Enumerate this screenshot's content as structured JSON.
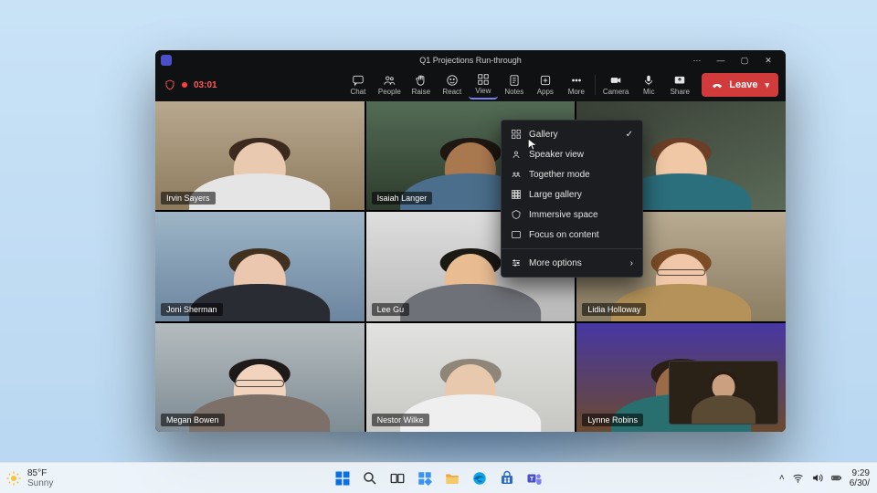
{
  "meeting": {
    "title": "Q1 Projections Run-through",
    "recording_time": "03:01"
  },
  "toolbar": {
    "chat": "Chat",
    "people": "People",
    "raise": "Raise",
    "react": "React",
    "view": "View",
    "notes": "Notes",
    "apps": "Apps",
    "more": "More",
    "camera": "Camera",
    "mic": "Mic",
    "share": "Share",
    "leave_label": "Leave"
  },
  "view_menu": {
    "gallery": "Gallery",
    "speaker": "Speaker view",
    "together": "Together mode",
    "large_gallery": "Large gallery",
    "immersive": "Immersive space",
    "focus": "Focus on content",
    "more_options": "More options"
  },
  "participants": [
    {
      "name": "Irvin Sayers",
      "skin": "#e9c9b0",
      "shirt": "#e5e5e5",
      "hair": "#3b2a1d",
      "bg": "linear-gradient(180deg,#b8a88e,#8e7b5e)"
    },
    {
      "name": "Isaiah Langer",
      "skin": "#a9784f",
      "shirt": "#4a6e8b",
      "hair": "#1e1712",
      "bg": "linear-gradient(180deg,#536b55,#2e3c2d)"
    },
    {
      "name": "",
      "skin": "#f1c8a6",
      "shirt": "#2b6e7c",
      "hair": "#6a3e27",
      "bg": "linear-gradient(160deg,#3a4036,#5a6a58)"
    },
    {
      "name": "Joni Sherman",
      "skin": "#ecc7af",
      "shirt": "#2a2c33",
      "hair": "#40301f",
      "bg": "linear-gradient(180deg,#9db5c6,#6d86a0)"
    },
    {
      "name": "Lee Gu",
      "skin": "#e9bc92",
      "shirt": "#6f7178",
      "hair": "#1b1914",
      "bg": "linear-gradient(180deg,#dedede,#b9b9b9)"
    },
    {
      "name": "Lidia Holloway",
      "skin": "#f0c8a9",
      "shirt": "#b49259",
      "hair": "#7c4c27",
      "bg": "linear-gradient(180deg,#b8ab92,#8c7e63)"
    },
    {
      "name": "Megan Bowen",
      "skin": "#f2d3bd",
      "shirt": "#7d7068",
      "hair": "#1e1a19",
      "bg": "linear-gradient(180deg,#b5bcbf,#7e8c94)"
    },
    {
      "name": "Nestor Wilke",
      "skin": "#e8c9ae",
      "shirt": "#efefef",
      "hair": "#8f8679",
      "bg": "linear-gradient(180deg,#e2e2e0,#c7c7c3)"
    },
    {
      "name": "Lynne Robins",
      "skin": "#9b6a47",
      "shirt": "#2a6f6f",
      "hair": "#2a1e17",
      "bg": "linear-gradient(180deg,#4637a3,#6b4a2e)"
    }
  ],
  "pip": {
    "skin": "#caa080",
    "shirt": "#5a4a34",
    "hair": "#2a1d15",
    "bg": "linear-gradient(180deg,#4a3a25,#2a2216)"
  },
  "taskbar": {
    "weather_temp": "85°F",
    "weather_desc": "Sunny",
    "clock_time": "9:29",
    "clock_date": "6/30/"
  }
}
